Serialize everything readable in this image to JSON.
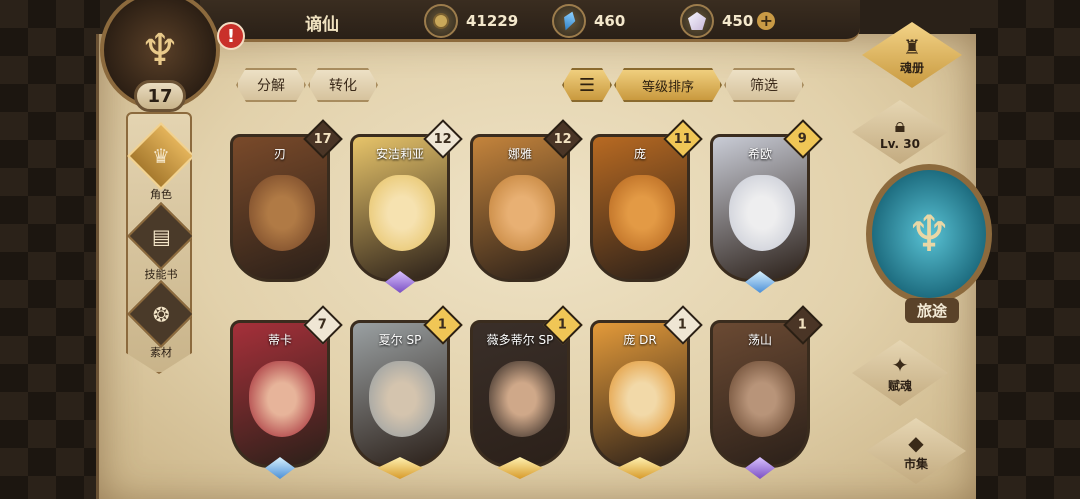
{
  "player": {
    "name": "谪仙",
    "level": "17",
    "alert": "!"
  },
  "resources": {
    "gold": {
      "icon": "coin-icon",
      "value": "41229"
    },
    "crystal": {
      "icon": "crystal-icon",
      "value": "460"
    },
    "gem": {
      "icon": "gem-icon",
      "value": "450",
      "plus": "+"
    }
  },
  "leftnav": [
    {
      "label": "角色",
      "icon": "helmet-icon",
      "active": true
    },
    {
      "label": "技能书",
      "icon": "book-icon",
      "active": false
    },
    {
      "label": "素材",
      "icon": "material-icon",
      "active": false
    }
  ],
  "filters": {
    "decompose": "分解",
    "convert": "转化",
    "sort_icon": "sort-icon",
    "sort_level": "等级排序",
    "filter": "筛选"
  },
  "heroes": [
    {
      "name": "刃",
      "level": "17",
      "badge": "dark",
      "base": "none",
      "colors": [
        "#7a4a2a",
        "#b07a45"
      ]
    },
    {
      "name": "安洁莉亚",
      "level": "12",
      "badge": "light",
      "base": "purple",
      "colors": [
        "#e7c46a",
        "#f6e2b0"
      ]
    },
    {
      "name": "娜雅",
      "level": "12",
      "badge": "dark",
      "base": "none",
      "colors": [
        "#c4843c",
        "#e8b073"
      ]
    },
    {
      "name": "庞",
      "level": "11",
      "badge": "gold",
      "base": "none",
      "colors": [
        "#b86a22",
        "#e39a45"
      ]
    },
    {
      "name": "希欧",
      "level": "9",
      "badge": "gold",
      "base": "blue",
      "colors": [
        "#c9ccd6",
        "#eeeeef"
      ]
    },
    {
      "name": "蒂卡",
      "level": "7",
      "badge": "light",
      "base": "blue",
      "colors": [
        "#a6303a",
        "#e7b49a"
      ]
    },
    {
      "name": "夏尔 SP",
      "level": "1",
      "badge": "gold",
      "base": "gold",
      "colors": [
        "#9aa0a2",
        "#d4c4ae"
      ]
    },
    {
      "name": "薇多蒂尔 SP",
      "level": "1",
      "badge": "gold",
      "base": "gold",
      "colors": [
        "#3a2f29",
        "#cfa889"
      ]
    },
    {
      "name": "庞 DR",
      "level": "1",
      "badge": "light",
      "base": "gold",
      "colors": [
        "#e39a3a",
        "#f2d9a8"
      ]
    },
    {
      "name": "荡山",
      "level": "1",
      "badge": "dark",
      "base": "purple",
      "colors": [
        "#6b4a33",
        "#b89479"
      ]
    }
  ],
  "rightmenu": {
    "soul_book": {
      "label": "魂册",
      "icon": "soul-book-icon"
    },
    "lock": {
      "label": "Lv. 30",
      "icon": "lock-icon"
    },
    "journey": {
      "label": "旅途",
      "icon": "journey-emblem-icon"
    },
    "talent": {
      "label": "赋魂",
      "icon": "talent-icon"
    },
    "market": {
      "label": "市集",
      "icon": "market-icon"
    }
  }
}
